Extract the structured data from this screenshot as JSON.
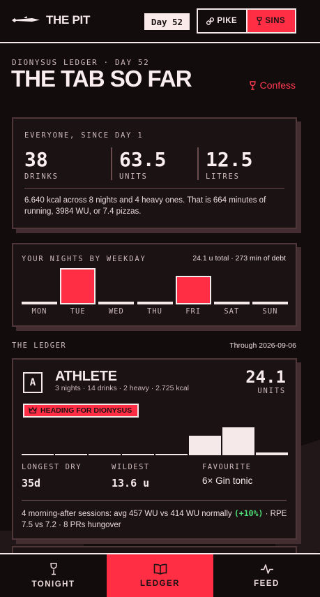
{
  "colors": {
    "accent": "#ff2e44",
    "bg": "#130c0d",
    "card": "#1b1213",
    "text": "#f6e9e9",
    "positive": "#4ddf7a"
  },
  "brand": {
    "name": "THE PIT",
    "icon": "pike-fish-icon"
  },
  "day_chip": "Day 52",
  "toggle": {
    "pike_label": "PIKE",
    "sins_label": "SINS",
    "active": "SINS"
  },
  "header": {
    "kicker": "DIONYSUS LEDGER · DAY 52",
    "title": "THE TAB SO FAR",
    "confess_label": "Confess"
  },
  "totals": {
    "label": "EVERYONE, SINCE DAY 1",
    "stats": [
      {
        "value": "38",
        "unit": "DRINKS"
      },
      {
        "value": "63.5",
        "unit": "UNITS"
      },
      {
        "value": "12.5",
        "unit": "LITRES"
      }
    ],
    "blurb": "6.640 kcal across 8 nights and 4 heavy ones. That is 664 minutes of running, 3984 WU, or 7.4 pizzas."
  },
  "weekday": {
    "label": "YOUR NIGHTS BY WEEKDAY",
    "meta": "24.1 u total · 273 min of debt",
    "days": [
      {
        "label": "MON",
        "level": 0.08,
        "hot": false
      },
      {
        "label": "TUE",
        "level": 1.0,
        "hot": true
      },
      {
        "label": "WED",
        "level": 0.08,
        "hot": false
      },
      {
        "label": "THU",
        "level": 0.08,
        "hot": false
      },
      {
        "label": "FRI",
        "level": 0.78,
        "hot": true
      },
      {
        "label": "SAT",
        "level": 0.08,
        "hot": false
      },
      {
        "label": "SUN",
        "level": 0.08,
        "hot": false
      }
    ]
  },
  "ledger": {
    "heading": "THE LEDGER",
    "through": "Through 2026-09-06"
  },
  "athlete": {
    "grade": "A",
    "name": "ATHLETE",
    "sub": "3 nights · 14 drinks · 2 heavy · 2.725 kcal",
    "units_value": "24.1",
    "units_label": "UNITS",
    "badge": "HEADING FOR DIONYSUS",
    "badge_icon": "crown-icon",
    "history": [
      0.05,
      0.05,
      0.05,
      0.05,
      0.05,
      0.62,
      0.9,
      0.08
    ],
    "stats": [
      {
        "label": "LONGEST DRY",
        "value": "35d"
      },
      {
        "label": "WILDEST",
        "value": "13.6 u"
      },
      {
        "label": "FAVOURITE",
        "value": "6× Gin tonic"
      }
    ],
    "note_prefix": "4 morning-after sessions: avg 457 WU vs 414 WU normally ",
    "note_pct": "(+10%)",
    "note_suffix": " · RPE 7.5 vs 7.2 · 8 PRs hungover"
  },
  "nav": [
    {
      "label": "TONIGHT",
      "icon": "wine-glass-icon",
      "active": false
    },
    {
      "label": "LEDGER",
      "icon": "open-book-icon",
      "active": true
    },
    {
      "label": "FEED",
      "icon": "pulse-icon",
      "active": false
    }
  ]
}
